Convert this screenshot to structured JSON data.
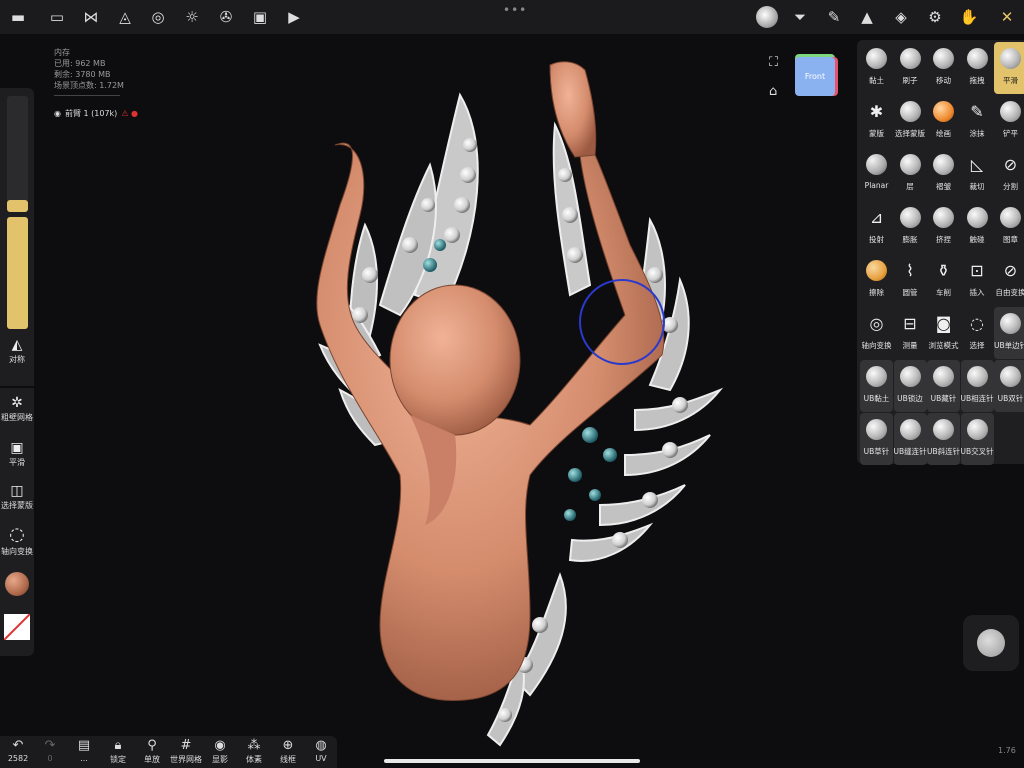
{
  "toolbar_top": {
    "icons": [
      "collapse-icon",
      "folder-icon",
      "scene-tree-icon",
      "shading-icon",
      "globe-icon",
      "sun-icon",
      "aperture-icon",
      "image-icon",
      "camera-icon"
    ],
    "right_icons": [
      "matcap-icon",
      "filter-icon",
      "brush-pen-icon",
      "tool-triangle-icon",
      "layers-icon",
      "settings-icon",
      "gesture-icon",
      "tools-icon"
    ]
  },
  "stats": {
    "title": "内存",
    "used": "已用: 962 MB",
    "remaining": "剩余: 3780 MB",
    "vertices": "场景顶点数: 1.72M"
  },
  "object": {
    "name": "前臂 1 (107k)"
  },
  "left_panel": {
    "symmetry_label": "对称",
    "remesh_label": "粗壁网格",
    "smooth_label": "平滑",
    "select_mask_label": "选择蒙版",
    "axis_transform_label": "轴向变换",
    "radius_fill": 0.1,
    "intensity_fill": 1.0
  },
  "bottom_bar": {
    "undo_count": "2582",
    "redo_count": "0",
    "items": [
      "...",
      "锁定",
      "单放",
      "世界网格",
      "显影",
      "体素",
      "线框",
      "UV"
    ]
  },
  "nav": {
    "cube_label": "Front"
  },
  "tools": [
    [
      "黏土",
      "刷子",
      "移动",
      "拖拽",
      "平滑"
    ],
    [
      "蒙版",
      "选择蒙版",
      "绘画",
      "涂抹",
      "铲平"
    ],
    [
      "Planar",
      "层",
      "褶皱",
      "裁切",
      "分割"
    ],
    [
      "投射",
      "膨胀",
      "挤捏",
      "触碰",
      "图章"
    ],
    [
      "擦除",
      "圆管",
      "车削",
      "插入",
      "自由变换"
    ],
    [
      "轴向变换",
      "测量",
      "浏览模式",
      "选择",
      "UB单边针"
    ],
    [
      "UB黏土",
      "UB锁边",
      "UB藏针",
      "UB相连针",
      "UB双针"
    ],
    [
      "UB草针",
      "UB缝连针",
      "UB斜连针",
      "UB交叉针"
    ]
  ],
  "selected_tool": "平滑",
  "version": "1.76",
  "colors": {
    "accent": "#e2c26a",
    "skin": "#d89073",
    "panel": "#1f1e20"
  }
}
